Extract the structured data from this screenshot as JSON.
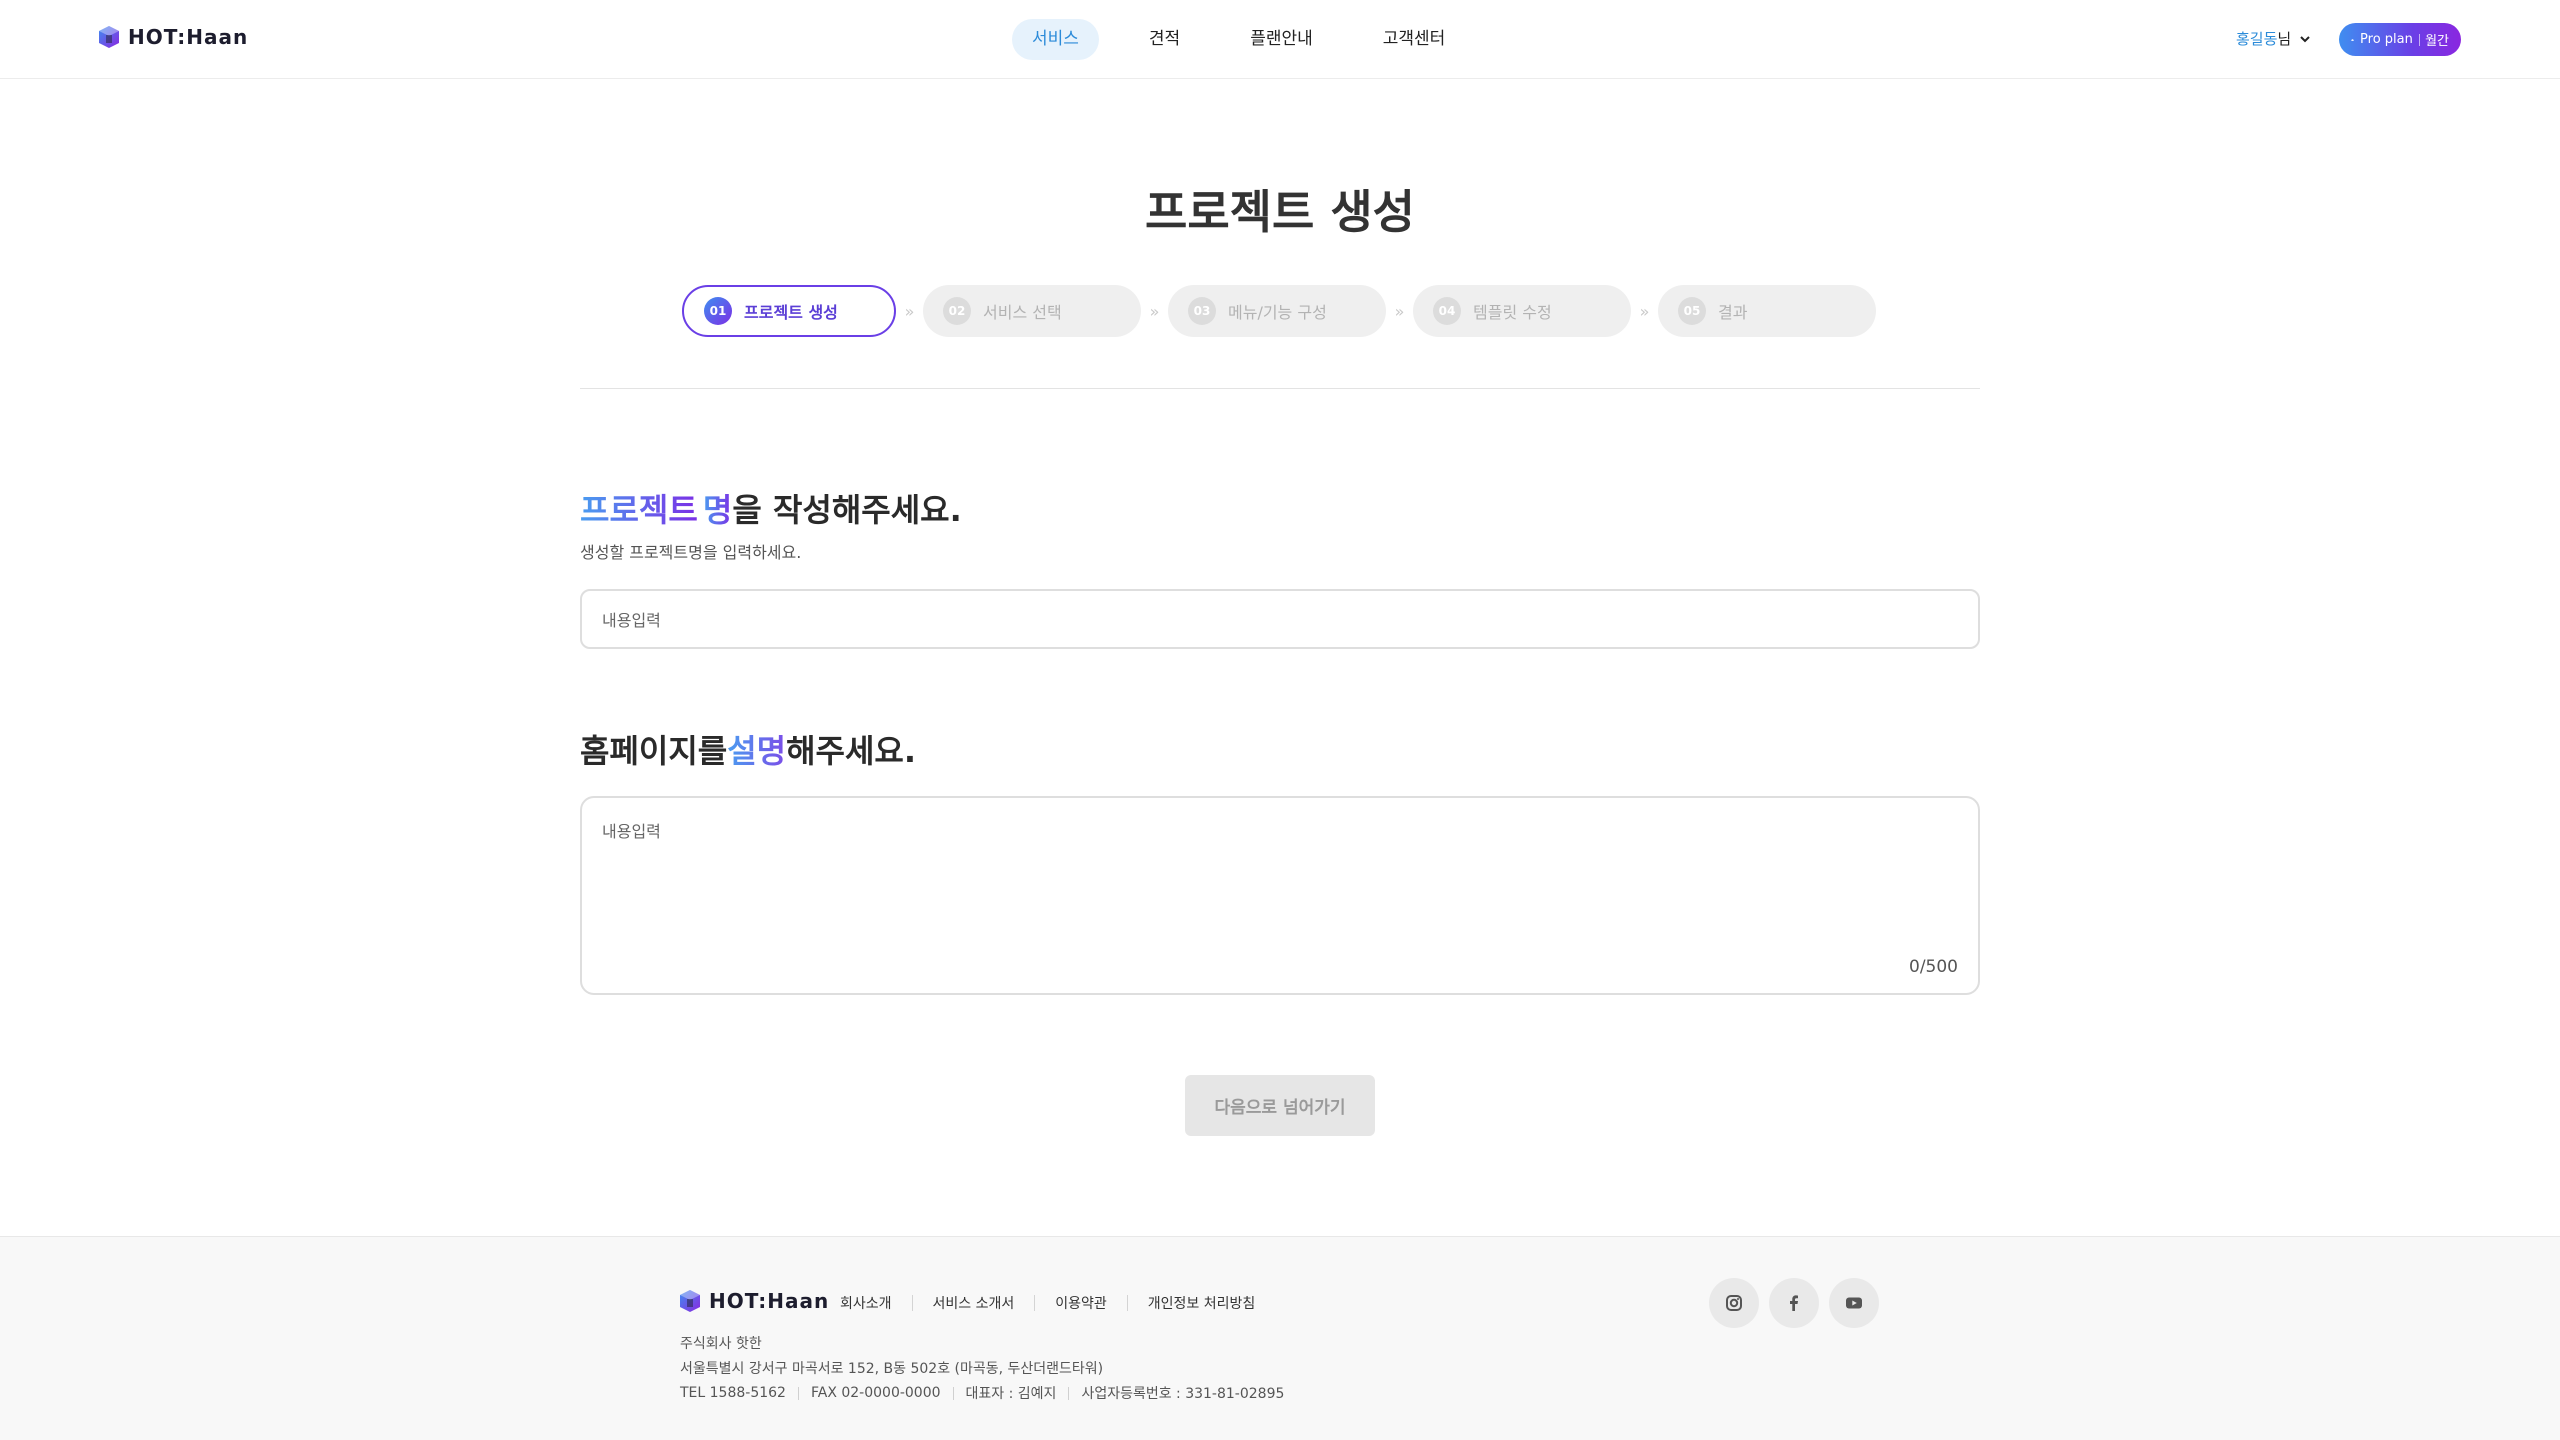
{
  "header": {
    "logo_text": "HOT:Haan",
    "nav": [
      {
        "label": "서비스",
        "active": true
      },
      {
        "label": "견적",
        "active": false
      },
      {
        "label": "플랜안내",
        "active": false
      },
      {
        "label": "고객센터",
        "active": false
      }
    ],
    "user_name": "홍길동",
    "user_suffix": "님",
    "plan_label": "Pro plan",
    "plan_period": "월간"
  },
  "page_title": "프로젝트 생성",
  "steps": [
    {
      "num": "01",
      "label": "프로젝트 생성",
      "active": true
    },
    {
      "num": "02",
      "label": "서비스 선택",
      "active": false
    },
    {
      "num": "03",
      "label": "메뉴/기능 구성",
      "active": false
    },
    {
      "num": "04",
      "label": "템플릿 수정",
      "active": false
    },
    {
      "num": "05",
      "label": "결과",
      "active": false
    }
  ],
  "step_separator": "»",
  "form": {
    "project_name": {
      "heading_highlight_1": "프로젝트",
      "heading_highlight_2": "명",
      "heading_rest": "을 작성해주세요.",
      "subtext": "생성할 프로젝트명을 입력하세요.",
      "placeholder": "내용입력",
      "value": ""
    },
    "description": {
      "heading_pre": "홈페이지를",
      "heading_highlight": "설명",
      "heading_rest": "해주세요.",
      "placeholder": "내용입력",
      "value": "",
      "counter": "0/500"
    }
  },
  "next_button_label": "다음으로 넘어가기",
  "footer": {
    "logo_text": "HOT:Haan",
    "links": [
      "회사소개",
      "서비스 소개서",
      "이용약관",
      "개인정보 처리방침"
    ],
    "company_name": "주식회사 핫한",
    "address": "서울특별시 강서구 마곡서로 152, B동 502호 (마곡동, 두산더랜드타워)",
    "info": [
      "TEL 1588-5162",
      "FAX 02-0000-0000",
      "대표자 : 김예지",
      "사업자등록번호 : 331-81-02895"
    ],
    "social": [
      "instagram-icon",
      "facebook-icon",
      "youtube-icon"
    ]
  },
  "colors": {
    "accent_blue": "#2b8bd9",
    "accent_purple": "#6a3fe6",
    "nav_active_bg": "#e6f2fc"
  }
}
